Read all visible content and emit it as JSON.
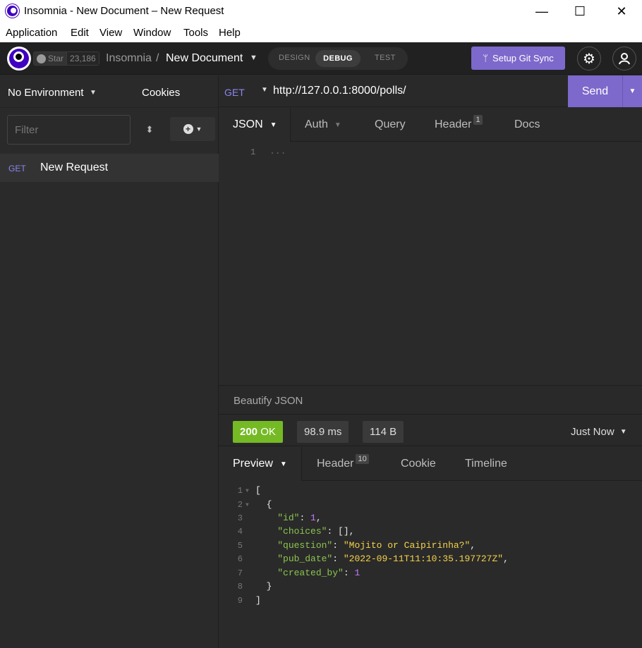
{
  "window": {
    "title": "Insomnia - New Document – New Request",
    "controls": {
      "minimize": "—",
      "maximize": "☐",
      "close": "✕"
    }
  },
  "menu": [
    "Application",
    "Edit",
    "View",
    "Window",
    "Tools",
    "Help"
  ],
  "toolbar": {
    "github": {
      "label": "Star",
      "count": "23,186"
    },
    "breadcrumb": {
      "app": "Insomnia",
      "separator": "/",
      "document": "New Document"
    },
    "mode_tabs": [
      "DESIGN",
      "DEBUG",
      "TEST"
    ],
    "active_mode": "DEBUG",
    "git_sync_label": "Setup Git Sync",
    "accent_color": "#7d69cb"
  },
  "sidebar": {
    "environment": "No Environment",
    "cookies": "Cookies",
    "filter_placeholder": "Filter",
    "requests": [
      {
        "method": "GET",
        "name": "New Request"
      }
    ]
  },
  "request": {
    "method": "GET",
    "url": "http://127.0.0.1:8000/polls/",
    "send_label": "Send",
    "tabs": [
      {
        "label": "JSON",
        "badge": ""
      },
      {
        "label": "Auth",
        "badge": ""
      },
      {
        "label": "Query",
        "badge": ""
      },
      {
        "label": "Header",
        "badge": "1"
      },
      {
        "label": "Docs",
        "badge": ""
      }
    ],
    "body_line_number": "1",
    "body_placeholder": "...",
    "beautify_label": "Beautify JSON"
  },
  "response": {
    "status_code": "200",
    "status_text": "OK",
    "status_color": "#75ba24",
    "time": "98.9 ms",
    "size": "114 B",
    "when": "Just Now",
    "tabs": [
      {
        "label": "Preview",
        "badge": ""
      },
      {
        "label": "Header",
        "badge": "10"
      },
      {
        "label": "Cookie",
        "badge": ""
      },
      {
        "label": "Timeline",
        "badge": ""
      }
    ],
    "body_lines": [
      {
        "n": "1",
        "text": "["
      },
      {
        "n": "2",
        "text": "  {"
      },
      {
        "n": "3",
        "key": "\"id\"",
        "value": "1",
        "type": "number",
        "suffix": ","
      },
      {
        "n": "4",
        "key": "\"choices\"",
        "value": "[]",
        "type": "plain",
        "suffix": ","
      },
      {
        "n": "5",
        "key": "\"question\"",
        "value": "\"Mojito or Caipirinha?\"",
        "type": "string",
        "suffix": ","
      },
      {
        "n": "6",
        "key": "\"pub_date\"",
        "value": "\"2022-09-11T11:10:35.197727Z\"",
        "type": "string",
        "suffix": ","
      },
      {
        "n": "7",
        "key": "\"created_by\"",
        "value": "1",
        "type": "number",
        "suffix": ""
      },
      {
        "n": "8",
        "text": "  }"
      },
      {
        "n": "9",
        "text": "]"
      }
    ]
  }
}
